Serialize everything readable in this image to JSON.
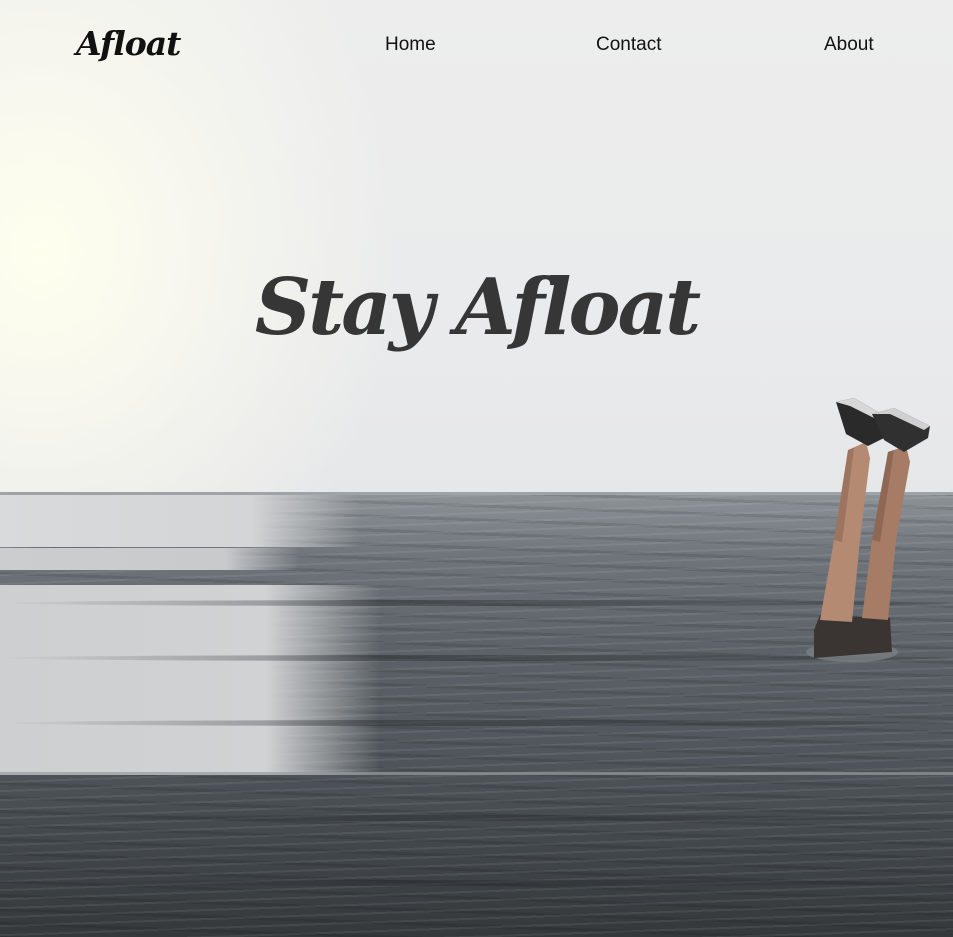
{
  "brand": {
    "logo_text": "Afloat"
  },
  "nav": {
    "items": [
      {
        "label": "Home"
      },
      {
        "label": "Contact"
      },
      {
        "label": "About"
      }
    ]
  },
  "hero": {
    "title": "Stay Afloat",
    "image_description_icon": "person-diving-into-sea-icon"
  },
  "colors": {
    "text": "#111111",
    "hero_text": "#363636",
    "sky": "#ebebec",
    "sea": "#555b60"
  }
}
